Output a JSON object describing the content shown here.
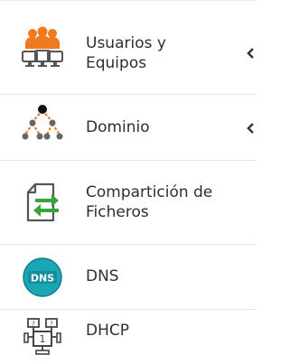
{
  "menu": {
    "items": [
      {
        "label_line1": "Usuarios y",
        "label_line2": "Equipos",
        "icon": "users-computers-icon",
        "has_submenu": true
      },
      {
        "label_line1": "Dominio",
        "label_line2": "",
        "icon": "domain-tree-icon",
        "has_submenu": true
      },
      {
        "label_line1": "Compartición de",
        "label_line2": "Ficheros",
        "icon": "file-sharing-icon",
        "has_submenu": false
      },
      {
        "label_line1": "DNS",
        "label_line2": "",
        "icon": "dns-icon",
        "has_submenu": false
      },
      {
        "label_line1": "DHCP",
        "label_line2": "",
        "icon": "dhcp-icon",
        "has_submenu": false
      }
    ]
  },
  "colors": {
    "accent_orange": "#f07a22",
    "accent_green": "#3aa33a",
    "accent_teal": "#1aa7b5",
    "text": "#2f2f2f",
    "separator": "#e6e6e6"
  }
}
